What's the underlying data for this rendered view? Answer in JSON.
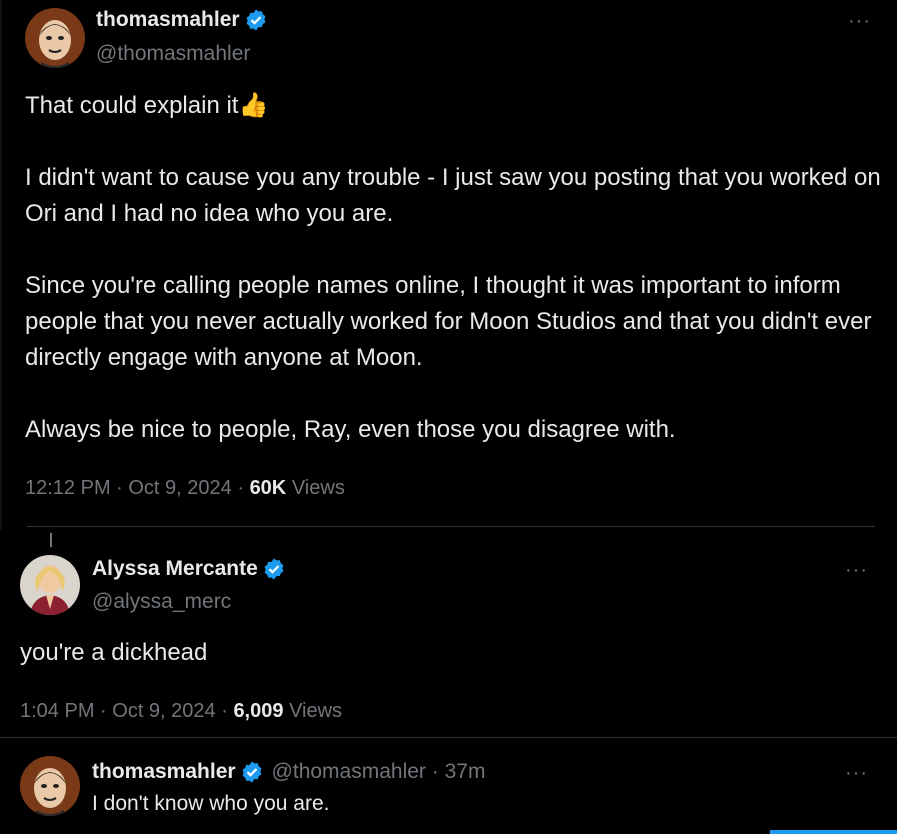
{
  "tweet1": {
    "display_name": "thomasmahler",
    "handle": "@thomasmahler",
    "paragraphs": [
      "That could explain it👍",
      "I didn't want to cause you any trouble - I just saw you posting that you worked on Ori and I had no idea who you are.",
      "Since you're calling people names online, I thought it was important to inform people that you never actually worked for Moon Studios and that you didn't ever directly engage with anyone at Moon.",
      "Always be nice to people, Ray, even those you disagree with."
    ],
    "time": "12:12 PM · Oct 9, 2024 · ",
    "views_count": "60K",
    "views_label": "Views",
    "more_label": "···"
  },
  "tweet2": {
    "display_name": "Alyssa Mercante",
    "handle": "@alyssa_merc",
    "text": "you're a dickhead",
    "time": "1:04 PM · Oct 9, 2024 · ",
    "views_count": "6,009",
    "views_label": "Views",
    "more_label": "···"
  },
  "tweet3": {
    "display_name": "thomasmahler",
    "handle_time": "@thomasmahler · 37m",
    "text": "I don't know who you are.",
    "more_label": "···"
  },
  "icons": {
    "verified": "verified-badge-icon",
    "more": "more-options-icon"
  },
  "colors": {
    "background": "#000000",
    "text_primary": "#e7e9ea",
    "text_secondary": "#71767b",
    "verified_blue": "#1d9bf0",
    "divider": "#2f3336"
  }
}
